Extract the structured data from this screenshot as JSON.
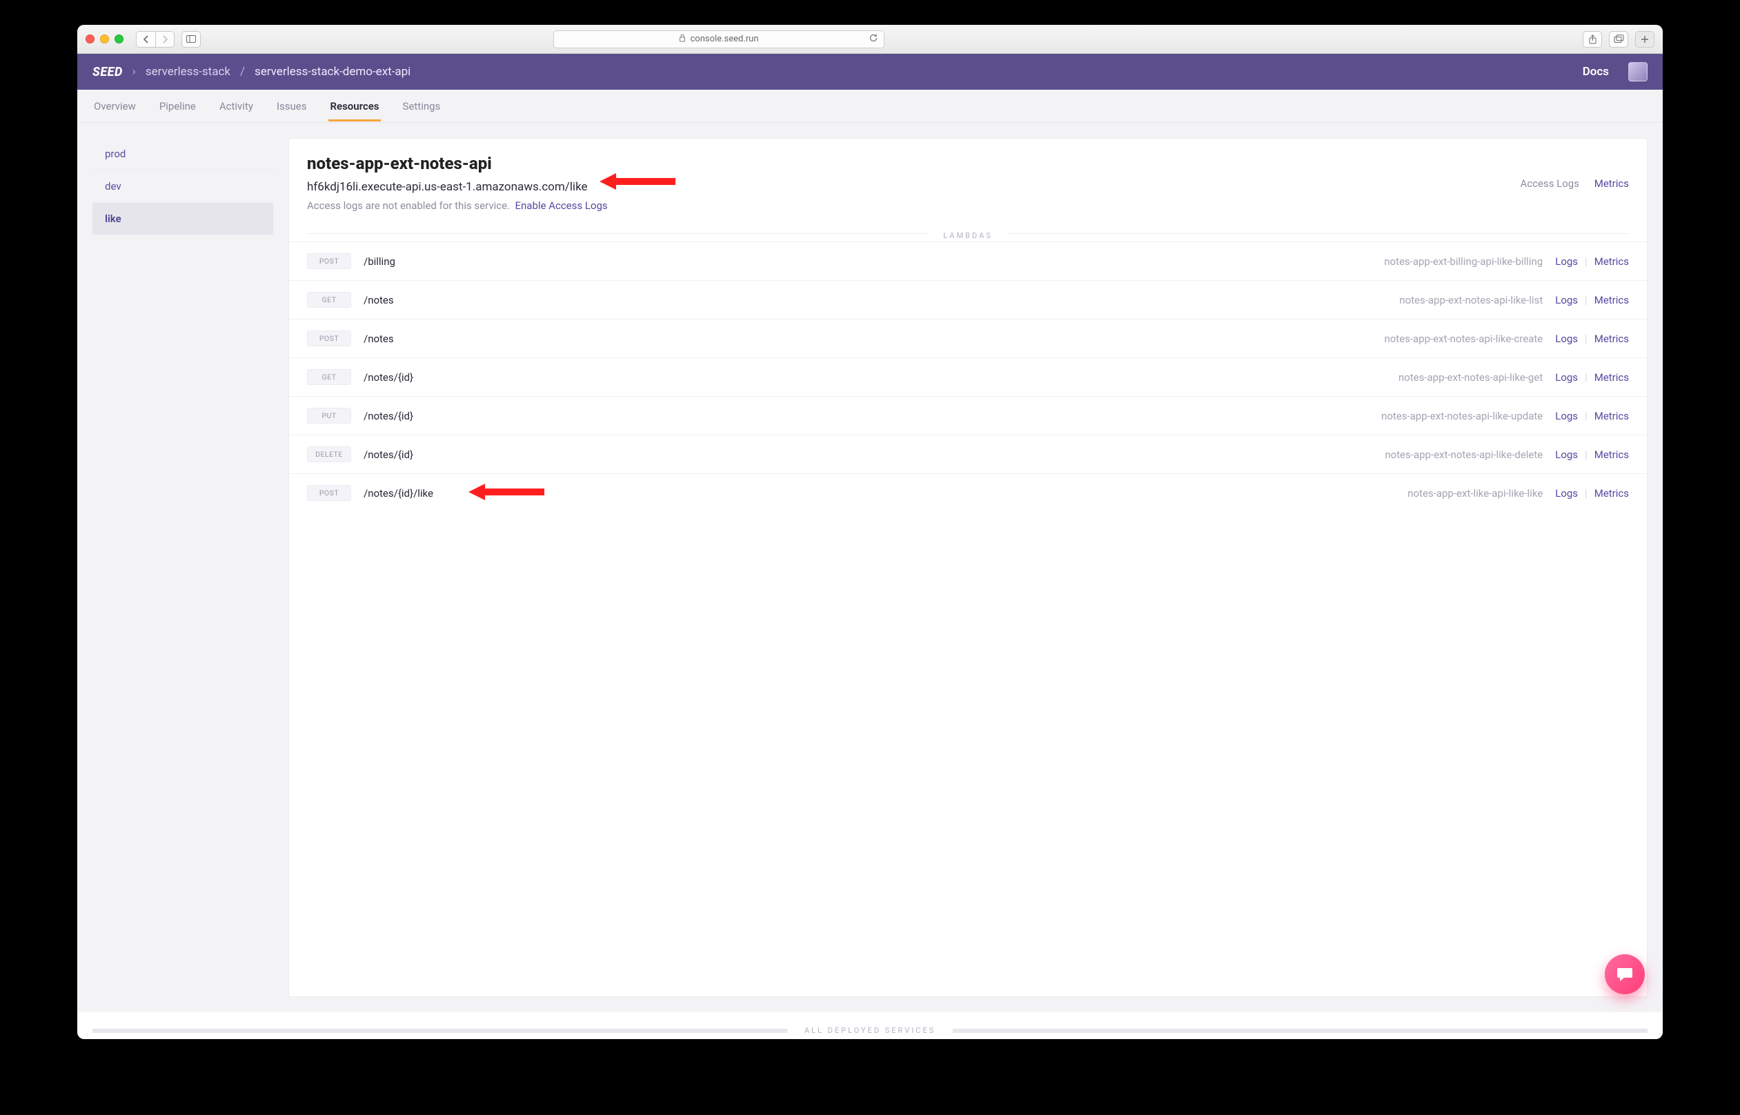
{
  "browser": {
    "address": "console.seed.run"
  },
  "header": {
    "logo": "SEED",
    "breadcrumb_org": "serverless-stack",
    "breadcrumb_app": "serverless-stack-demo-ext-api",
    "docs_label": "Docs"
  },
  "tabs": {
    "items": [
      {
        "label": "Overview",
        "active": false
      },
      {
        "label": "Pipeline",
        "active": false
      },
      {
        "label": "Activity",
        "active": false
      },
      {
        "label": "Issues",
        "active": false
      },
      {
        "label": "Resources",
        "active": true
      },
      {
        "label": "Settings",
        "active": false
      }
    ]
  },
  "sidebar": {
    "items": [
      {
        "label": "prod",
        "active": false
      },
      {
        "label": "dev",
        "active": false
      },
      {
        "label": "like",
        "active": true
      }
    ]
  },
  "panel": {
    "title": "notes-app-ext-notes-api",
    "endpoint": "hf6kdj16li.execute-api.us-east-1.amazonaws.com/like",
    "access_note": "Access logs are not enabled for this service.",
    "enable_access_logs": "Enable Access Logs",
    "access_logs_link": "Access Logs",
    "metrics_link": "Metrics",
    "lambdas_label": "LAMBDAS",
    "logs_label": "Logs",
    "row_metrics_label": "Metrics",
    "rows": [
      {
        "method": "POST",
        "path": "/billing",
        "fn": "notes-app-ext-billing-api-like-billing"
      },
      {
        "method": "GET",
        "path": "/notes",
        "fn": "notes-app-ext-notes-api-like-list"
      },
      {
        "method": "POST",
        "path": "/notes",
        "fn": "notes-app-ext-notes-api-like-create"
      },
      {
        "method": "GET",
        "path": "/notes/{id}",
        "fn": "notes-app-ext-notes-api-like-get"
      },
      {
        "method": "PUT",
        "path": "/notes/{id}",
        "fn": "notes-app-ext-notes-api-like-update"
      },
      {
        "method": "DELETE",
        "path": "/notes/{id}",
        "fn": "notes-app-ext-notes-api-like-delete"
      },
      {
        "method": "POST",
        "path": "/notes/{id}/like",
        "fn": "notes-app-ext-like-api-like-like"
      }
    ],
    "all_deployed_label": "ALL DEPLOYED SERVICES"
  }
}
